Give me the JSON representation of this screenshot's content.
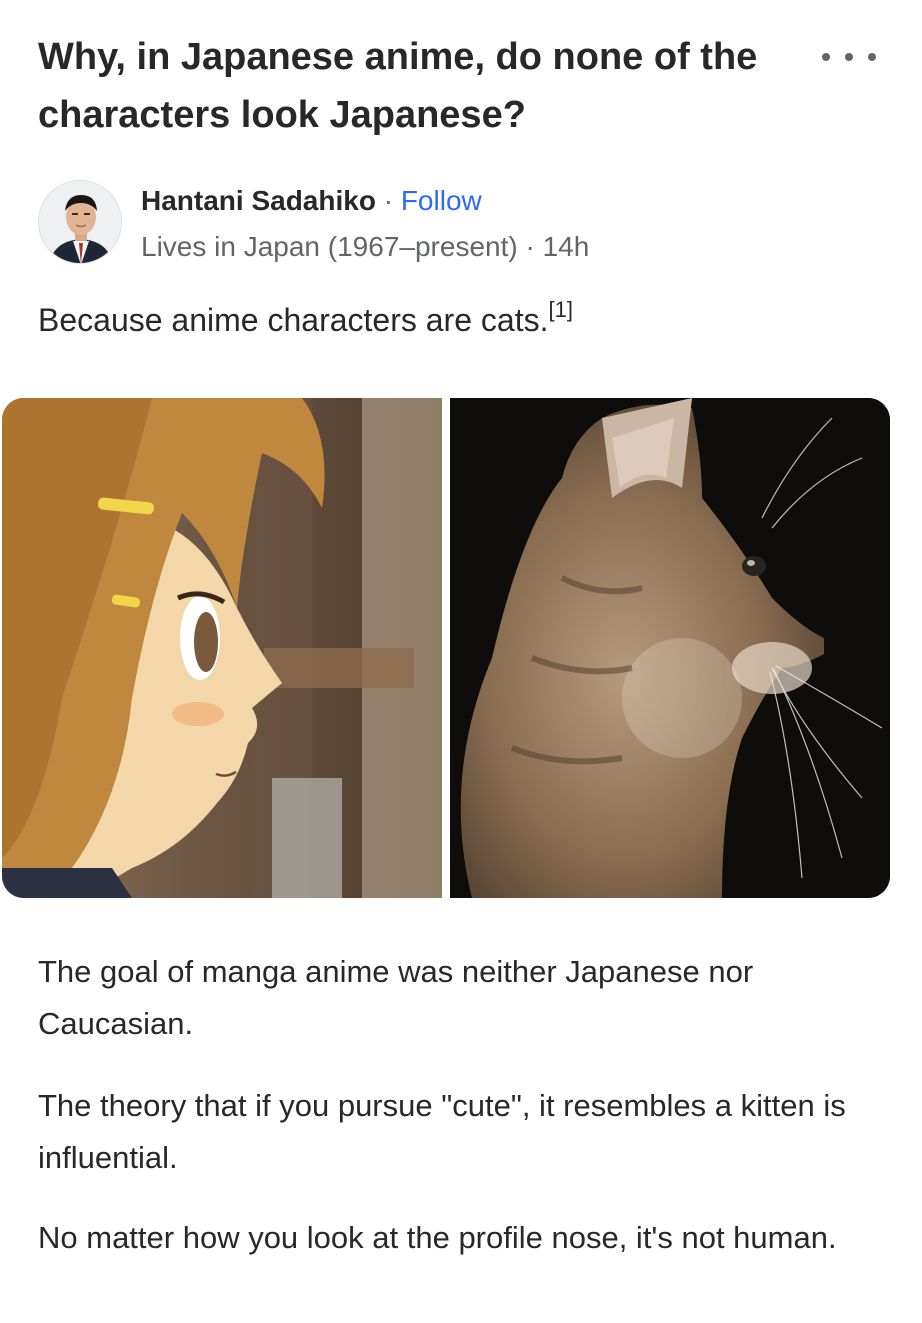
{
  "question": {
    "title": "Why, in Japanese anime, do none of the characters look Japanese?"
  },
  "more_menu": {
    "icon": "more-horizontal-icon"
  },
  "author": {
    "name": "Hantani Sadahiko",
    "separator": " · ",
    "follow_label": "Follow",
    "credential": "Lives in Japan (1967–present)",
    "time_separator": " · ",
    "timestamp": "14h"
  },
  "answer": {
    "intro": "Because anime characters are cats.",
    "footnote": "[1]",
    "paragraphs": [
      "The goal of manga anime was neither Japanese nor Caucasian.",
      "The theory that if you pursue \"cute\", it resembles a kitten is influential.",
      "No matter how you look at the profile nose, it's not human."
    ]
  },
  "colors": {
    "text": "#282829",
    "secondary_text": "#636466",
    "link": "#2e69ff",
    "background": "#ffffff"
  }
}
